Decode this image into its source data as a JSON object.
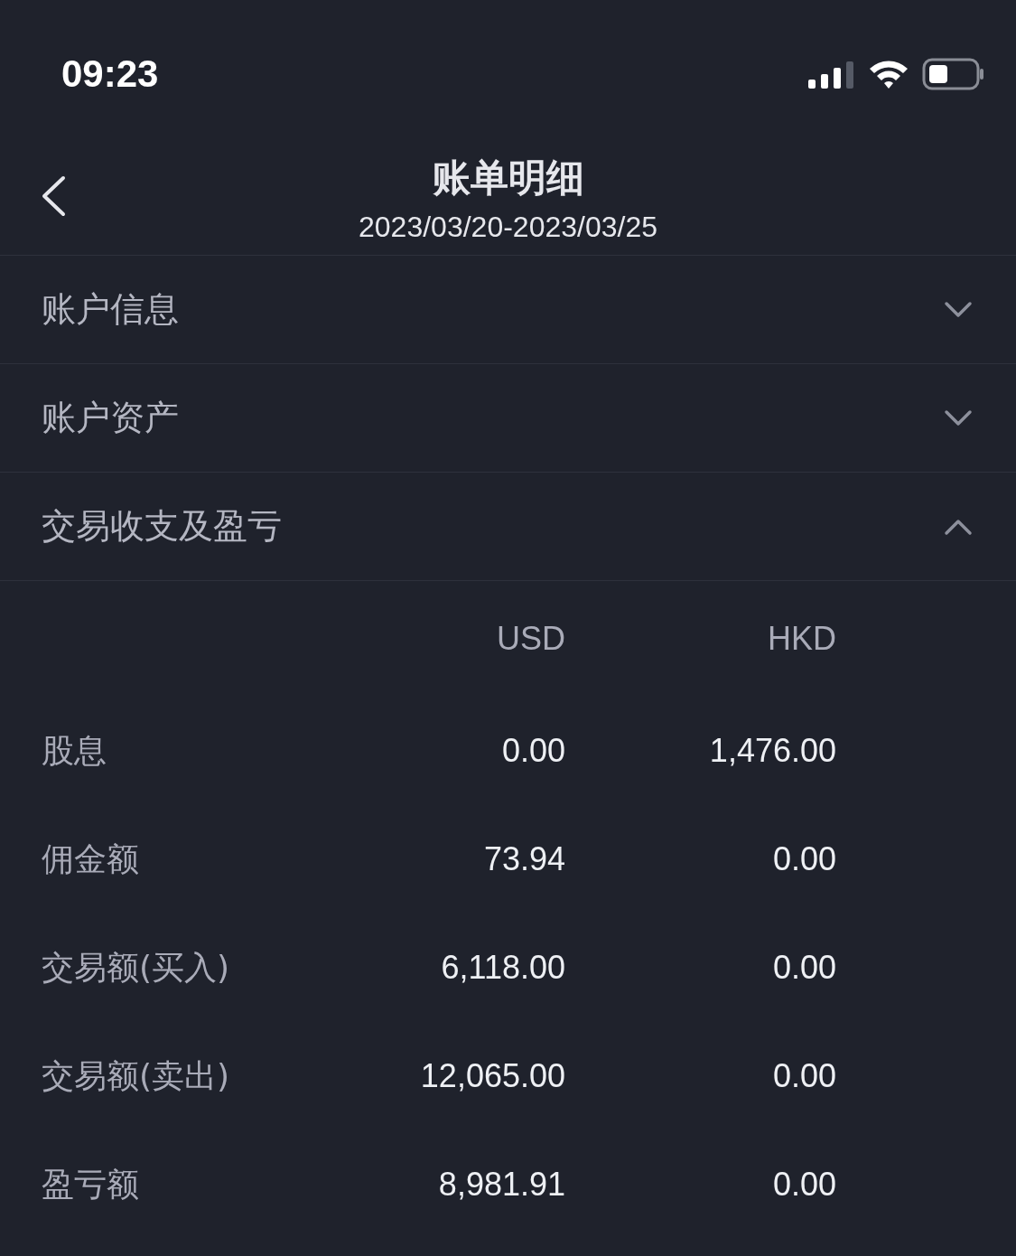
{
  "status_bar": {
    "time": "09:23"
  },
  "header": {
    "title": "账单明细",
    "subtitle": "2023/03/20-2023/03/25"
  },
  "sections": [
    {
      "label": "账户信息",
      "expanded": false
    },
    {
      "label": "账户资产",
      "expanded": false
    },
    {
      "label": "交易收支及盈亏",
      "expanded": true
    }
  ],
  "table": {
    "columns": [
      "USD",
      "HKD"
    ],
    "rows": [
      {
        "label": "股息",
        "values": [
          "0.00",
          "1,476.00"
        ]
      },
      {
        "label": "佣金额",
        "values": [
          "73.94",
          "0.00"
        ]
      },
      {
        "label": "交易额(买入)",
        "values": [
          "6,118.00",
          "0.00"
        ]
      },
      {
        "label": "交易额(卖出)",
        "values": [
          "12,065.00",
          "0.00"
        ]
      },
      {
        "label": "盈亏额",
        "values": [
          "8,981.91",
          "0.00"
        ]
      }
    ]
  }
}
